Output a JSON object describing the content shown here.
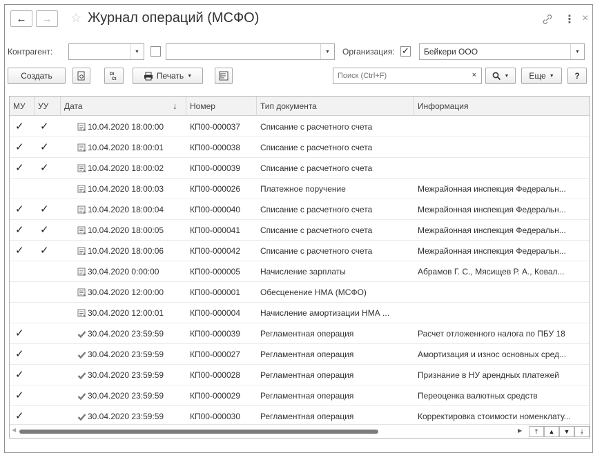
{
  "window": {
    "title": "Журнал операций (МСФО)",
    "back_icon": "←",
    "forward_icon": "→",
    "star_icon": "☆",
    "link_icon": "🔗",
    "more_icon": "⋮",
    "close_icon": "×"
  },
  "filters": {
    "counterparty_label": "Контрагент:",
    "counterparty_value": "",
    "counterparty_text_value": "",
    "organization_label": "Организация:",
    "organization_checked": "✓",
    "organization_value": "Бейкери ООО",
    "dropdown_glyph": "▼"
  },
  "toolbar": {
    "create_label": "Создать",
    "print_label": "Печать",
    "search_placeholder": "Поиск (Ctrl+F)",
    "clear_icon": "×",
    "search_icon": "🔍",
    "more_label": "Еще",
    "help_label": "?",
    "caret": "▼"
  },
  "table": {
    "columns": [
      "МУ",
      "УУ",
      "Дата",
      "Номер",
      "Тип документа",
      "Информация"
    ],
    "sort_indicator": "↓",
    "rows": [
      {
        "mu": "✓",
        "uu": "✓",
        "icon": "doc",
        "date": "10.04.2020 18:00:00",
        "number": "КП00-000037",
        "type": "Списание с расчетного счета",
        "info": ""
      },
      {
        "mu": "✓",
        "uu": "✓",
        "icon": "doc",
        "date": "10.04.2020 18:00:01",
        "number": "КП00-000038",
        "type": "Списание с расчетного счета",
        "info": ""
      },
      {
        "mu": "✓",
        "uu": "✓",
        "icon": "doc",
        "date": "10.04.2020 18:00:02",
        "number": "КП00-000039",
        "type": "Списание с расчетного счета",
        "info": ""
      },
      {
        "mu": "",
        "uu": "",
        "icon": "doc",
        "date": "10.04.2020 18:00:03",
        "number": "КП00-000026",
        "type": "Платежное поручение",
        "info": "Межрайонная инспекция Федеральн..."
      },
      {
        "mu": "✓",
        "uu": "✓",
        "icon": "doc",
        "date": "10.04.2020 18:00:04",
        "number": "КП00-000040",
        "type": "Списание с расчетного счета",
        "info": "Межрайонная инспекция Федеральн..."
      },
      {
        "mu": "✓",
        "uu": "✓",
        "icon": "doc",
        "date": "10.04.2020 18:00:05",
        "number": "КП00-000041",
        "type": "Списание с расчетного счета",
        "info": "Межрайонная инспекция Федеральн..."
      },
      {
        "mu": "✓",
        "uu": "✓",
        "icon": "doc",
        "date": "10.04.2020 18:00:06",
        "number": "КП00-000042",
        "type": "Списание с расчетного счета",
        "info": "Межрайонная инспекция Федеральн..."
      },
      {
        "mu": "",
        "uu": "",
        "icon": "doc",
        "date": "30.04.2020 0:00:00",
        "number": "КП00-000005",
        "type": "Начисление зарплаты",
        "info": "Абрамов Г. С., Мясищев Р. А., Ковал..."
      },
      {
        "mu": "",
        "uu": "",
        "icon": "doc",
        "date": "30.04.2020 12:00:00",
        "number": "КП00-000001",
        "type": "Обесценение НМА (МСФО)",
        "info": ""
      },
      {
        "mu": "",
        "uu": "",
        "icon": "doc",
        "date": "30.04.2020 12:00:01",
        "number": "КП00-000004",
        "type": "Начисление амортизации НМА ...",
        "info": ""
      },
      {
        "mu": "✓",
        "uu": "",
        "icon": "reg",
        "date": "30.04.2020 23:59:59",
        "number": "КП00-000039",
        "type": "Регламентная операция",
        "info": "Расчет отложенного налога по ПБУ 18"
      },
      {
        "mu": "✓",
        "uu": "",
        "icon": "reg",
        "date": "30.04.2020 23:59:59",
        "number": "КП00-000027",
        "type": "Регламентная операция",
        "info": "Амортизация и износ основных сред..."
      },
      {
        "mu": "✓",
        "uu": "",
        "icon": "reg",
        "date": "30.04.2020 23:59:59",
        "number": "КП00-000028",
        "type": "Регламентная операция",
        "info": "Признание в НУ арендных платежей"
      },
      {
        "mu": "✓",
        "uu": "",
        "icon": "reg",
        "date": "30.04.2020 23:59:59",
        "number": "КП00-000029",
        "type": "Регламентная операция",
        "info": "Переоценка валютных средств"
      },
      {
        "mu": "✓",
        "uu": "",
        "icon": "reg",
        "date": "30.04.2020 23:59:59",
        "number": "КП00-000030",
        "type": "Регламентная операция",
        "info": "Корректировка стоимости номенклату..."
      }
    ]
  },
  "scroll": {
    "left_arrow": "◀",
    "right_arrow": "▶",
    "first_icon": "⏫",
    "up_icon": "▲",
    "down_icon": "▼",
    "last_icon": "⏬"
  }
}
